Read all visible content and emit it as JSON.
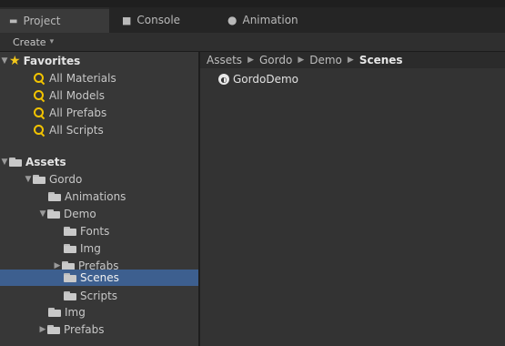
{
  "tabs": [
    {
      "label": "Project",
      "active": true,
      "icon": "project-icon"
    },
    {
      "label": "Console",
      "active": false,
      "icon": "console-icon"
    },
    {
      "label": "Animation",
      "active": false,
      "icon": "animation-icon"
    }
  ],
  "toolbar": {
    "create_label": "Create",
    "create_arrow": "▾"
  },
  "sidebar": {
    "favorites_label": "Favorites",
    "favorites": [
      "All Materials",
      "All Models",
      "All Prefabs",
      "All Scripts"
    ],
    "assets_label": "Assets",
    "tree": {
      "gordo": "Gordo",
      "animations": "Animations",
      "demo": "Demo",
      "fonts": "Fonts",
      "img": "Img",
      "prefabs": "Prefabs",
      "scenes": "Scenes",
      "scripts": "Scripts",
      "img2": "Img",
      "prefabs2": "Prefabs"
    }
  },
  "breadcrumb": [
    "Assets",
    "Gordo",
    "Demo",
    "Scenes"
  ],
  "assets_list": [
    {
      "name": "GordoDemo",
      "icon": "unity-scene-icon"
    }
  ],
  "colors": {
    "selection": "#3d5f8f",
    "favorites_star": "#f3c71a",
    "search_icon": "#f2c300"
  }
}
